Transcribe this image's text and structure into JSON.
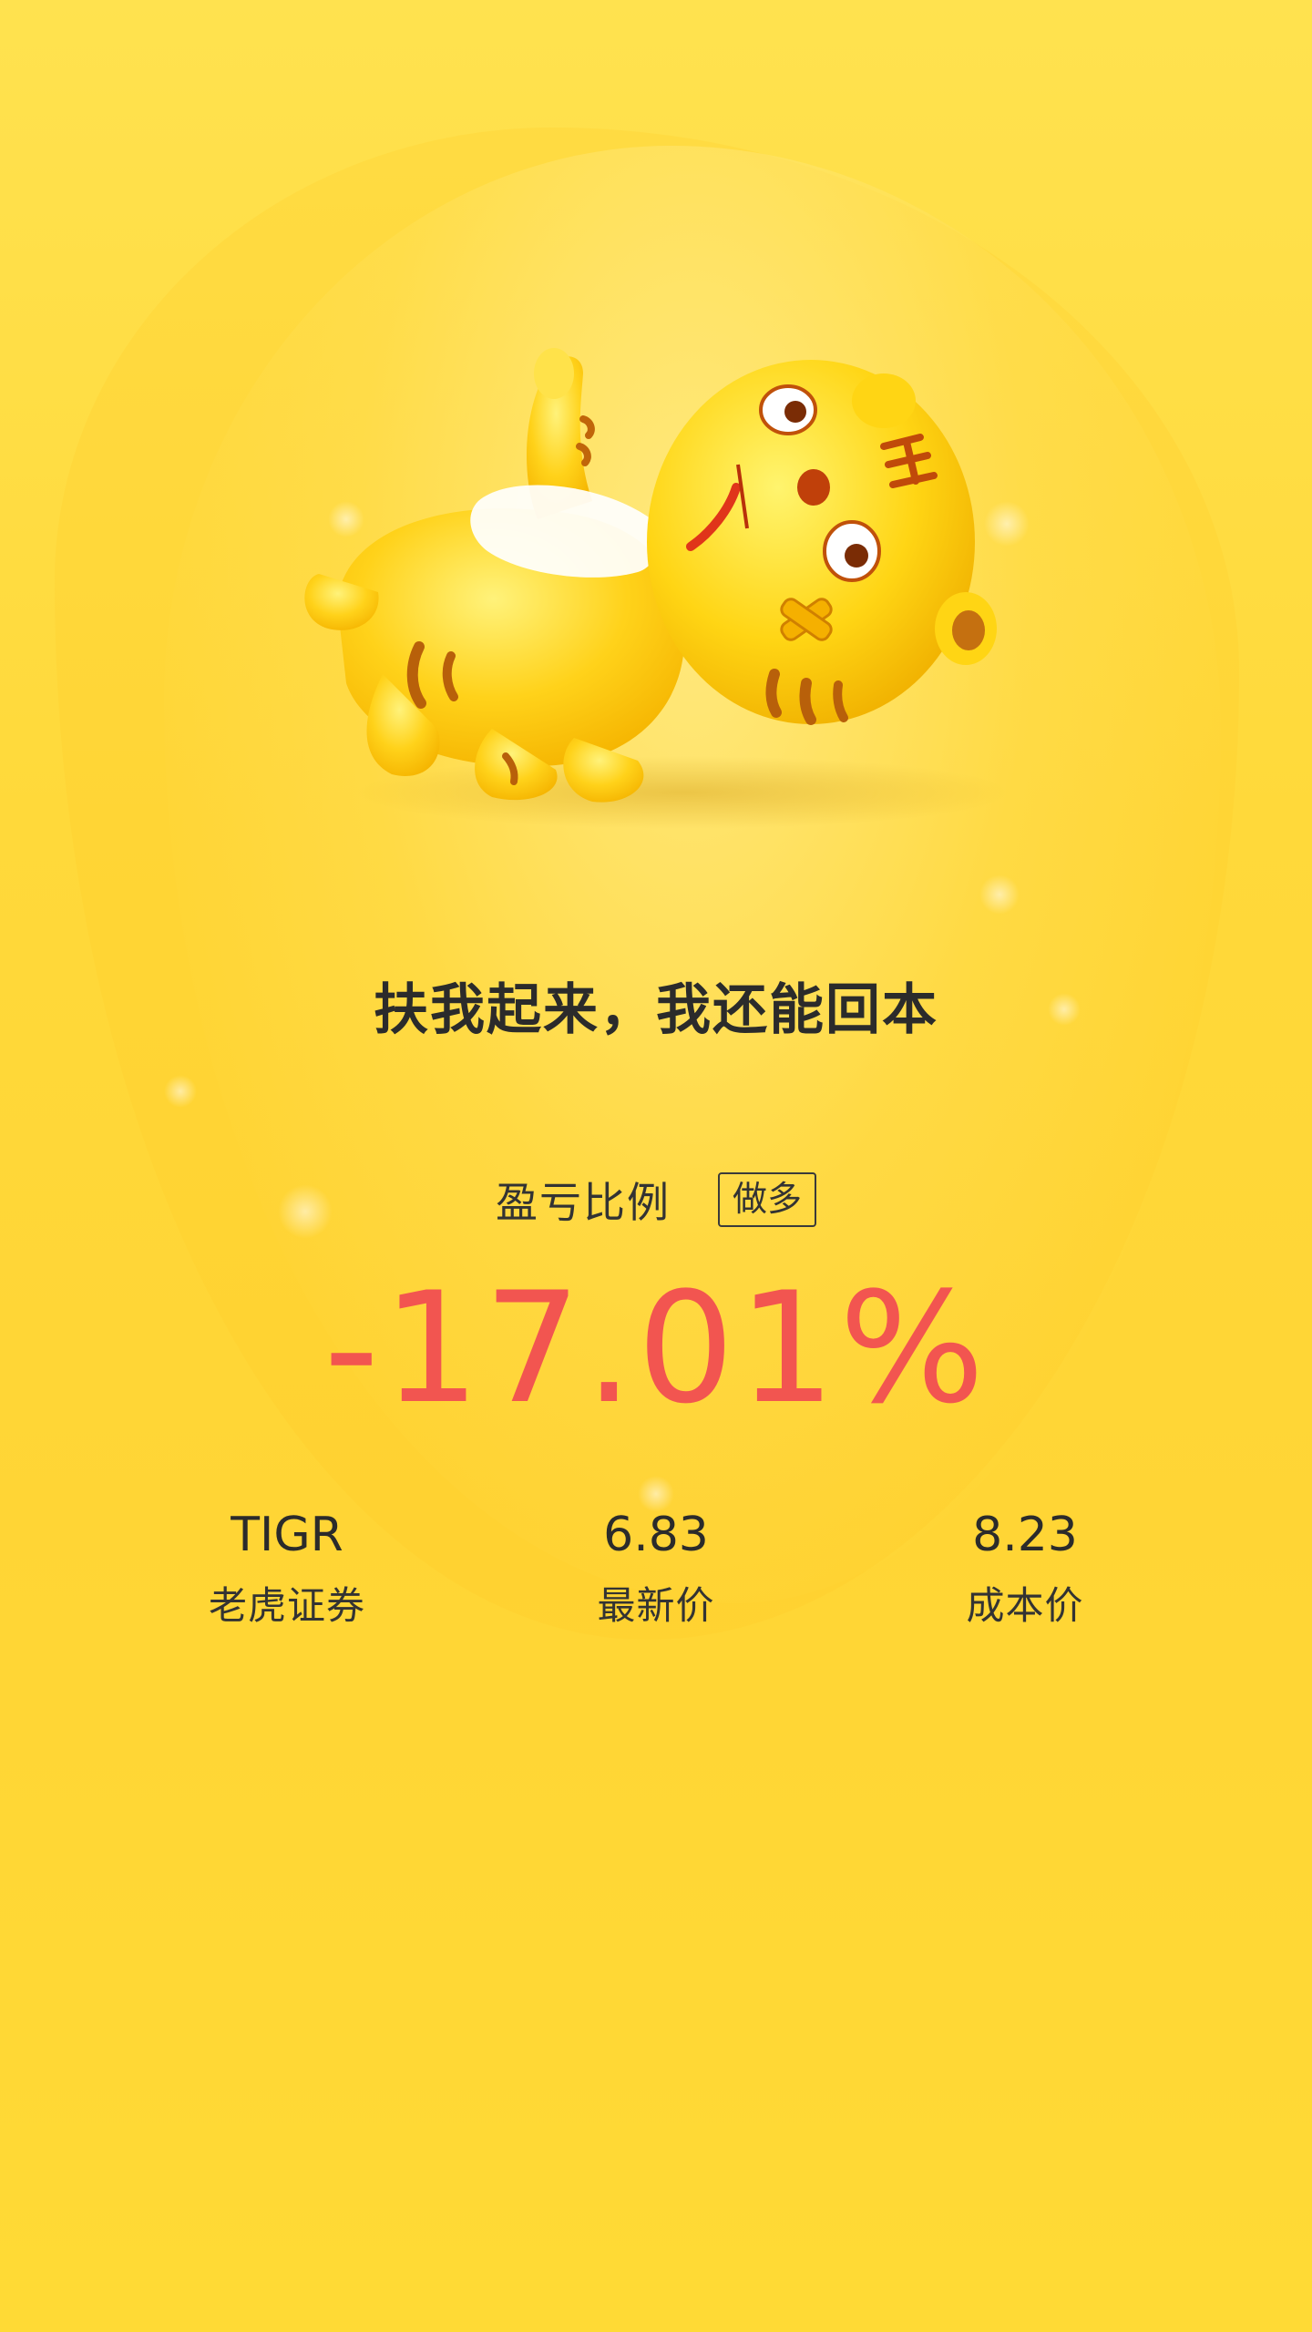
{
  "headline": "扶我起来，我还能回本",
  "pnl": {
    "label": "盈亏比例",
    "direction_badge": "做多",
    "value": "-17.01%"
  },
  "stats": [
    {
      "value": "TIGR",
      "label": "老虎证券"
    },
    {
      "value": "6.83",
      "label": "最新价"
    },
    {
      "value": "8.23",
      "label": "成本价"
    }
  ],
  "mascot": {
    "icon": "lying-tiger-mascot"
  },
  "colors": {
    "background": "#ffd93a",
    "loss_red": "#f25550",
    "text_dark": "#2b2b2b"
  }
}
